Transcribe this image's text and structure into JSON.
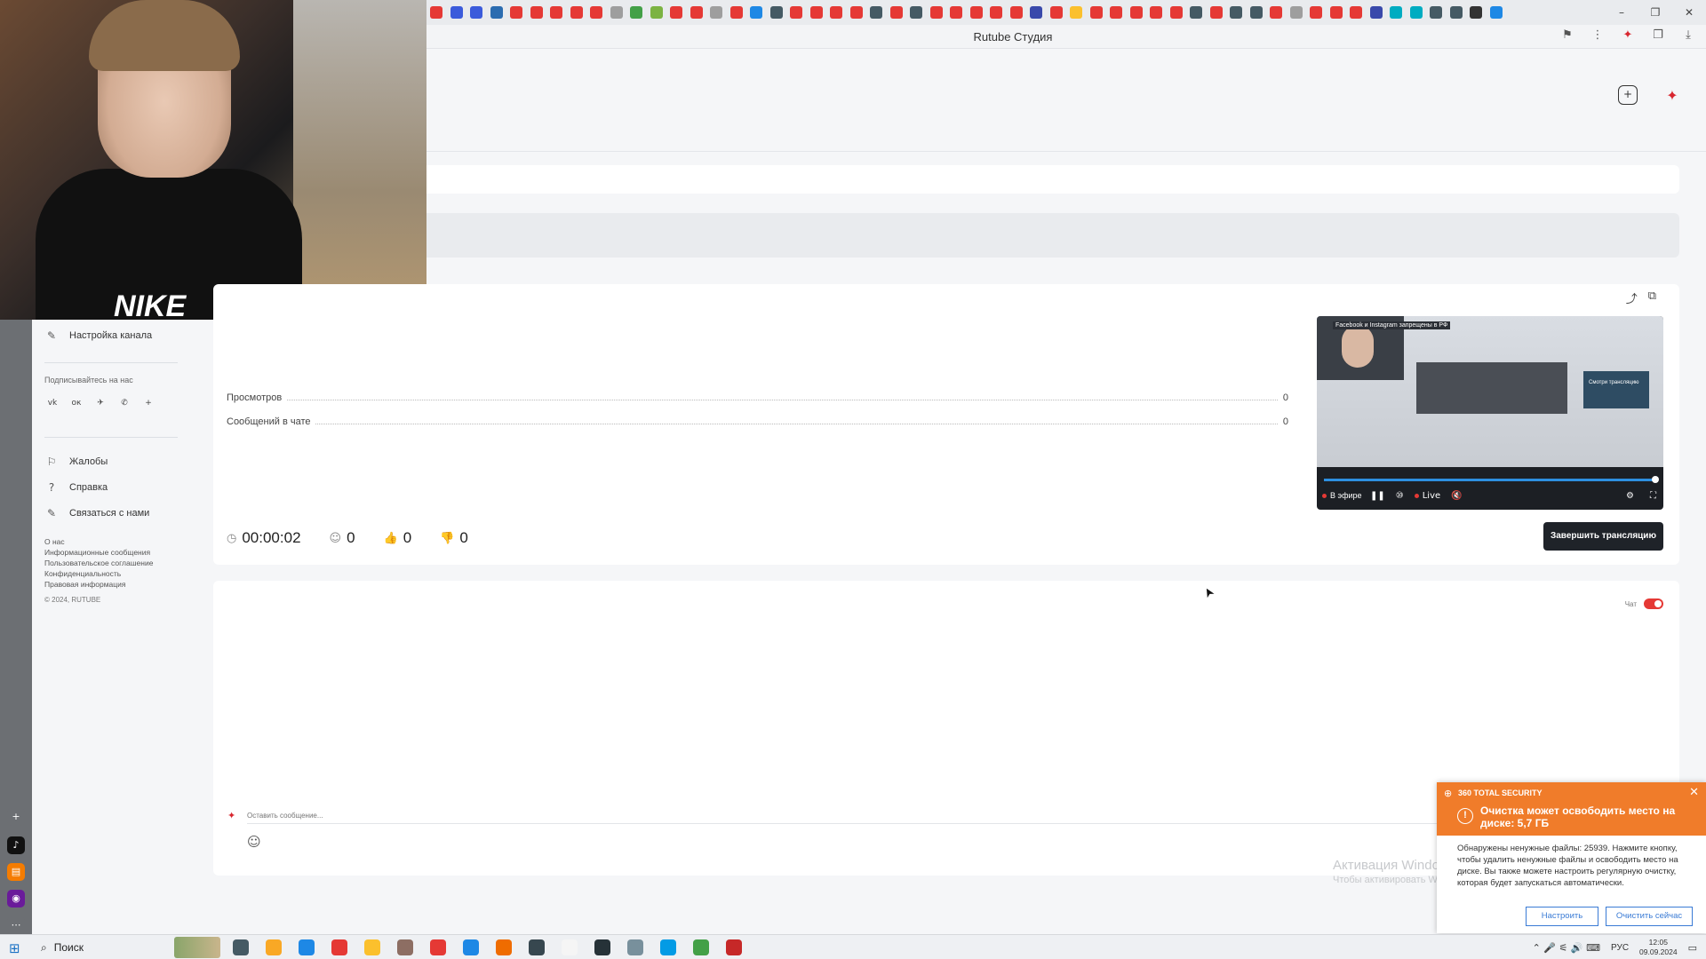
{
  "browser": {
    "page_title": "Rutube Студия",
    "window_controls": {
      "minimize": "–",
      "restore": "❐",
      "close": "✕"
    },
    "addr_icons": {
      "bookmark": "⚑",
      "menu": "⋮",
      "ext": "✦",
      "collections": "❐",
      "download": "⤓"
    },
    "tab_favicons": [
      "#e53935",
      "#3b5bdb",
      "#3b5bdb",
      "#2b6cb0",
      "#e53935",
      "#e53935",
      "#e53935",
      "#e53935",
      "#e53935",
      "#9e9e9e",
      "#43a047",
      "#7cb342",
      "#e53935",
      "#e53935",
      "#9e9e9e",
      "#e53935",
      "#1e88e5",
      "#455a64",
      "#e53935",
      "#e53935",
      "#e53935",
      "#e53935",
      "#455a64",
      "#e53935",
      "#455a64",
      "#e53935",
      "#e53935",
      "#e53935",
      "#e53935",
      "#e53935",
      "#3949ab",
      "#e53935",
      "#fbc02d",
      "#e53935",
      "#e53935",
      "#e53935",
      "#e53935",
      "#e53935",
      "#455a64",
      "#e53935",
      "#455a64",
      "#455a64",
      "#e53935",
      "#9e9e9e",
      "#e53935",
      "#e53935",
      "#e53935",
      "#3949ab",
      "#00acc1",
      "#00acc1",
      "#455a64",
      "#455a64",
      "#333333",
      "#1e88e5"
    ]
  },
  "header": {
    "upload_icon": "+",
    "avatar_icon": "✦"
  },
  "sidebar": {
    "channel_settings": "Настройка канала",
    "channel_settings_icon": "✎",
    "subscribe_heading": "Подписывайтесь на нас",
    "social": [
      "vk",
      "ок",
      "✈",
      "✆",
      "+"
    ],
    "items": [
      {
        "label": "Жалобы",
        "icon": "⚐"
      },
      {
        "label": "Справка",
        "icon": "?"
      },
      {
        "label": "Связаться с нами",
        "icon": "✎"
      }
    ],
    "footer_links": [
      "О нас",
      "Информационные сообщения",
      "Пользовательское соглашение",
      "Конфиденциальность",
      "Правовая информация"
    ],
    "copyright": "© 2024, RUTUBE"
  },
  "side_strip": {
    "icons": [
      {
        "glyph": "+",
        "color": "#6c6f73"
      },
      {
        "glyph": "♪",
        "color": "#111111"
      },
      {
        "glyph": "▤",
        "color": "#f57c00"
      },
      {
        "glyph": "◉",
        "color": "#6a1b9a"
      },
      {
        "glyph": "⋯",
        "color": "#6c6f73"
      }
    ]
  },
  "webcam": {
    "shirt_logo": "NIKE"
  },
  "stats": {
    "share_icon": "⤴",
    "open_icon": "⧉",
    "rows": [
      {
        "label": "Просмотров",
        "value": "0"
      },
      {
        "label": "Сообщений в чате",
        "value": "0"
      }
    ],
    "duration": "00:00:02",
    "viewers": "0",
    "likes": "0",
    "dislikes": "0",
    "icons": {
      "clock": "◷",
      "viewers": "☺",
      "likes": "👍",
      "dislikes": "👎"
    }
  },
  "player": {
    "caption": "Facebook и Instagram запрещены в РФ",
    "side_text": "Смотри трансляцию",
    "on_air": "В эфире",
    "live": "Live",
    "icons": {
      "back": "↺",
      "pause": "❚❚",
      "replay10": "⑩",
      "mute": "🔇",
      "settings": "⚙",
      "fullscreen": "⛶"
    }
  },
  "end_stream_button": "Завершить трансляцию",
  "chat": {
    "toggle_label": "Чат",
    "toggle_on": true,
    "avatar_icon": "✦",
    "input_placeholder": "Оставить сообщение...",
    "emoji_icon": "☺"
  },
  "watermark": {
    "line1": "Активация Windows",
    "line2": "Чтобы активировать Windows, перейдите в раздел «Параметры»."
  },
  "toast": {
    "brand": "360 TOTAL SECURITY",
    "brand_icon": "⊕",
    "close_icon": "✕",
    "warn_icon": "!",
    "title": "Очистка может освободить место на диске: 5,7 ГБ",
    "body": "Обнаружены ненужные файлы: 25939. Нажмите кнопку, чтобы удалить ненужные файлы и освободить место на диске. Вы также можете настроить регулярную очистку, которая будет запускаться автоматически.",
    "btn_settings": "Настроить",
    "btn_clean": "Очистить сейчас",
    "accent": "#f07c2a"
  },
  "taskbar": {
    "start_icon": "⊞",
    "search_icon": "⌕",
    "search_label": "Поиск",
    "apps": [
      "#455a64",
      "#f9a825",
      "#1e88e5",
      "#e53935",
      "#fbc02d",
      "#8d6e63",
      "#e53935",
      "#1e88e5",
      "#ef6c00",
      "#37474f",
      "#f5f5f5",
      "#263238",
      "#78909c",
      "#039be5",
      "#43a047",
      "#c62828"
    ],
    "tray_icons": "⌃ 🎤 ⚟ 🔊 ⌨",
    "lang": "РУС",
    "time": "12:05",
    "date": "09.09.2024",
    "notif_icon": "▭"
  },
  "cursor_icon": "➤"
}
